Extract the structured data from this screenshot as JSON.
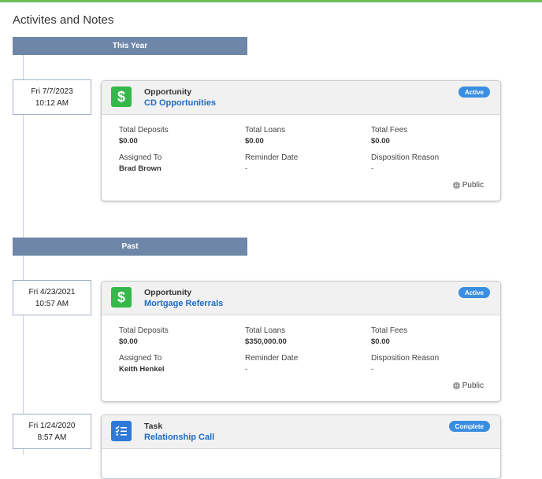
{
  "page": {
    "title": "Activites and Notes"
  },
  "sections": {
    "this_year": "This Year",
    "past": "Past"
  },
  "entries": [
    {
      "date": "Fri 7/7/2023",
      "time": "10:12 AM",
      "type": "Opportunity",
      "icon": "dollar-icon",
      "icon_color": "#35b84a",
      "name": "CD Opportunities",
      "status": "Active",
      "fields": {
        "total_deposits_label": "Total Deposits",
        "total_deposits": "$0.00",
        "total_loans_label": "Total Loans",
        "total_loans": "$0.00",
        "total_fees_label": "Total Fees",
        "total_fees": "$0.00",
        "assigned_to_label": "Assigned To",
        "assigned_to": "Brad Brown",
        "reminder_date_label": "Reminder Date",
        "reminder_date": "-",
        "disposition_reason_label": "Disposition Reason",
        "disposition_reason": "-"
      },
      "visibility": "Public"
    },
    {
      "date": "Fri 4/23/2021",
      "time": "10:57 AM",
      "type": "Opportunity",
      "icon": "dollar-icon",
      "icon_color": "#35b84a",
      "name": "Mortgage Referrals",
      "status": "Active",
      "fields": {
        "total_deposits_label": "Total Deposits",
        "total_deposits": "$0.00",
        "total_loans_label": "Total Loans",
        "total_loans": "$350,000.00",
        "total_fees_label": "Total Fees",
        "total_fees": "$0.00",
        "assigned_to_label": "Assigned To",
        "assigned_to": "Keith Henkel",
        "reminder_date_label": "Reminder Date",
        "reminder_date": "-",
        "disposition_reason_label": "Disposition Reason",
        "disposition_reason": "-"
      },
      "visibility": "Public"
    },
    {
      "date": "Fri 1/24/2020",
      "time": "8:57 AM",
      "type": "Task",
      "icon": "task-list-icon",
      "icon_color": "#2f7ad8",
      "name": "Relationship Call",
      "status": "Complete"
    }
  ],
  "colors": {
    "accent_green": "#6cbf59",
    "section_band": "#6e87a9",
    "link_blue": "#1f6bc4",
    "badge_blue": "#3a8ee0"
  }
}
